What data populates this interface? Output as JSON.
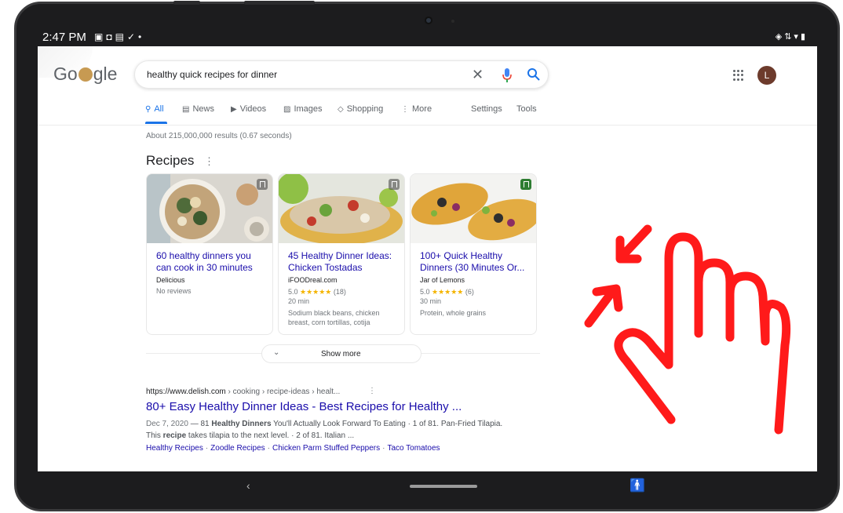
{
  "status_bar": {
    "time": "2:47 PM",
    "left_icons": [
      "image-icon",
      "shield-icon",
      "photo-icon",
      "check-icon",
      "dot-icon"
    ],
    "right_icons": [
      "vibrate-icon",
      "data-icon",
      "wifi-icon",
      "battery-icon"
    ]
  },
  "google": {
    "logo_text": "Google",
    "search": {
      "query": "healthy quick recipes for dinner"
    },
    "avatar_letter": "L",
    "tabs": [
      {
        "label": "All",
        "icon": "search-icon",
        "active": true
      },
      {
        "label": "News",
        "icon": "news-icon"
      },
      {
        "label": "Videos",
        "icon": "video-icon"
      },
      {
        "label": "Images",
        "icon": "image-icon"
      },
      {
        "label": "Shopping",
        "icon": "tag-icon"
      },
      {
        "label": "More",
        "icon": "more-icon"
      },
      {
        "label": "Settings"
      },
      {
        "label": "Tools"
      }
    ],
    "stats": "About 215,000,000 results (0.67 seconds)",
    "recipes": {
      "heading": "Recipes",
      "cards": [
        {
          "title": "60 healthy dinners you can cook in 30 minutes",
          "source": "Delicious",
          "rating_line": "No reviews",
          "time": "",
          "desc": ""
        },
        {
          "title": "45 Healthy Dinner Ideas: Chicken Tostadas",
          "source": "iFOODreal.com",
          "rating": "5.0",
          "stars": "★★★★★",
          "reviews": "(18)",
          "time": "20 min",
          "desc": "Sodium black beans, chicken breast, corn tortillas, cotija"
        },
        {
          "title": "100+ Quick Healthy Dinners (30 Minutes Or...",
          "source": "Jar of Lemons",
          "rating": "5.0",
          "stars": "★★★★★",
          "reviews": "(6)",
          "time": "30 min",
          "desc": "Protein, whole grains"
        }
      ],
      "show_more": "Show more"
    },
    "result": {
      "url_domain": "https://www.delish.com",
      "url_path": " › cooking › recipe-ideas › healt...",
      "title": "80+ Easy Healthy Dinner Ideas - Best Recipes for Healthy ...",
      "date": "Dec 7, 2020",
      "snippet_1": " — 81 ",
      "snippet_bold_1": "Healthy Dinners",
      "snippet_2": " You'll Actually Look Forward To Eating · 1 of 81. Pan-Fried Tilapia. This ",
      "snippet_bold_2": "recipe",
      "snippet_3": " takes tilapia to the next level. · 2 of 81. Italian ...",
      "links": [
        "Healthy Recipes",
        "Zoodle Recipes",
        "Chicken Parm Stuffed Peppers",
        "Taco Tomatoes"
      ]
    }
  },
  "nav_bar": {
    "back_glyph": "‹",
    "accessibility_glyph": "🚹"
  },
  "colors": {
    "link": "#1a0dab",
    "accent": "#1a73e8",
    "gesture": "#ff1a1a",
    "device": "#1c1c1e"
  }
}
